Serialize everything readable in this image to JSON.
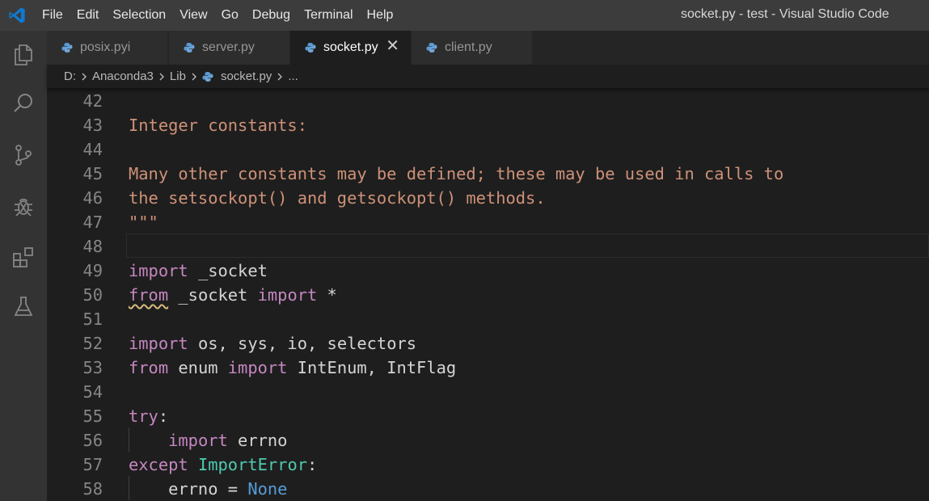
{
  "titlebar": {
    "menu": [
      "File",
      "Edit",
      "Selection",
      "View",
      "Go",
      "Debug",
      "Terminal",
      "Help"
    ],
    "window_title": "socket.py - test - Visual Studio Code"
  },
  "activity_bar": [
    "explorer-icon",
    "search-icon",
    "source-control-icon",
    "debug-icon",
    "extensions-icon",
    "test-icon"
  ],
  "tabs": [
    {
      "label": "posix.pyi",
      "active": false
    },
    {
      "label": "server.py",
      "active": false
    },
    {
      "label": "socket.py",
      "active": true,
      "close": "✕"
    },
    {
      "label": "client.py",
      "active": false
    }
  ],
  "breadcrumb": {
    "drive": "D:",
    "folder1": "Anaconda3",
    "folder2": "Lib",
    "file": "socket.py",
    "more": "..."
  },
  "editor": {
    "lines": [
      {
        "n": "42",
        "tokens": []
      },
      {
        "n": "43",
        "tokens": [
          {
            "t": "Integer constants:",
            "c": "str"
          }
        ]
      },
      {
        "n": "44",
        "tokens": []
      },
      {
        "n": "45",
        "tokens": [
          {
            "t": "Many other constants may be defined; these may be used in calls to",
            "c": "str"
          }
        ]
      },
      {
        "n": "46",
        "tokens": [
          {
            "t": "the setsockopt() and getsockopt() methods.",
            "c": "str"
          }
        ]
      },
      {
        "n": "47",
        "tokens": [
          {
            "t": "\"\"\"",
            "c": "str"
          }
        ]
      },
      {
        "n": "48",
        "tokens": [],
        "current": true
      },
      {
        "n": "49",
        "tokens": [
          {
            "t": "import",
            "c": "kw"
          },
          {
            "t": " _socket",
            "c": ""
          }
        ]
      },
      {
        "n": "50",
        "tokens": [
          {
            "t": "from",
            "c": "kw squig"
          },
          {
            "t": " _socket ",
            "c": ""
          },
          {
            "t": "import",
            "c": "kw"
          },
          {
            "t": " *",
            "c": ""
          }
        ]
      },
      {
        "n": "51",
        "tokens": []
      },
      {
        "n": "52",
        "tokens": [
          {
            "t": "import",
            "c": "kw"
          },
          {
            "t": " os, sys, io, selectors",
            "c": ""
          }
        ]
      },
      {
        "n": "53",
        "tokens": [
          {
            "t": "from",
            "c": "kw"
          },
          {
            "t": " enum ",
            "c": ""
          },
          {
            "t": "import",
            "c": "kw"
          },
          {
            "t": " IntEnum, IntFlag",
            "c": ""
          }
        ]
      },
      {
        "n": "54",
        "tokens": []
      },
      {
        "n": "55",
        "tokens": [
          {
            "t": "try",
            "c": "kw"
          },
          {
            "t": ":",
            "c": ""
          }
        ]
      },
      {
        "n": "56",
        "tokens": [
          {
            "t": "    ",
            "c": ""
          },
          {
            "t": "import",
            "c": "kw"
          },
          {
            "t": " errno",
            "c": ""
          }
        ]
      },
      {
        "n": "57",
        "tokens": [
          {
            "t": "except",
            "c": "kw"
          },
          {
            "t": " ",
            "c": ""
          },
          {
            "t": "ImportError",
            "c": "cls"
          },
          {
            "t": ":",
            "c": ""
          }
        ]
      },
      {
        "n": "58",
        "tokens": [
          {
            "t": "    errno = ",
            "c": ""
          },
          {
            "t": "None",
            "c": "const"
          }
        ]
      }
    ]
  },
  "colors": {
    "string": "#ce9178",
    "keyword": "#c586c0",
    "class": "#4ec9b0",
    "constant": "#569cd6",
    "text": "#d4d4d4",
    "line_number": "#858585"
  }
}
